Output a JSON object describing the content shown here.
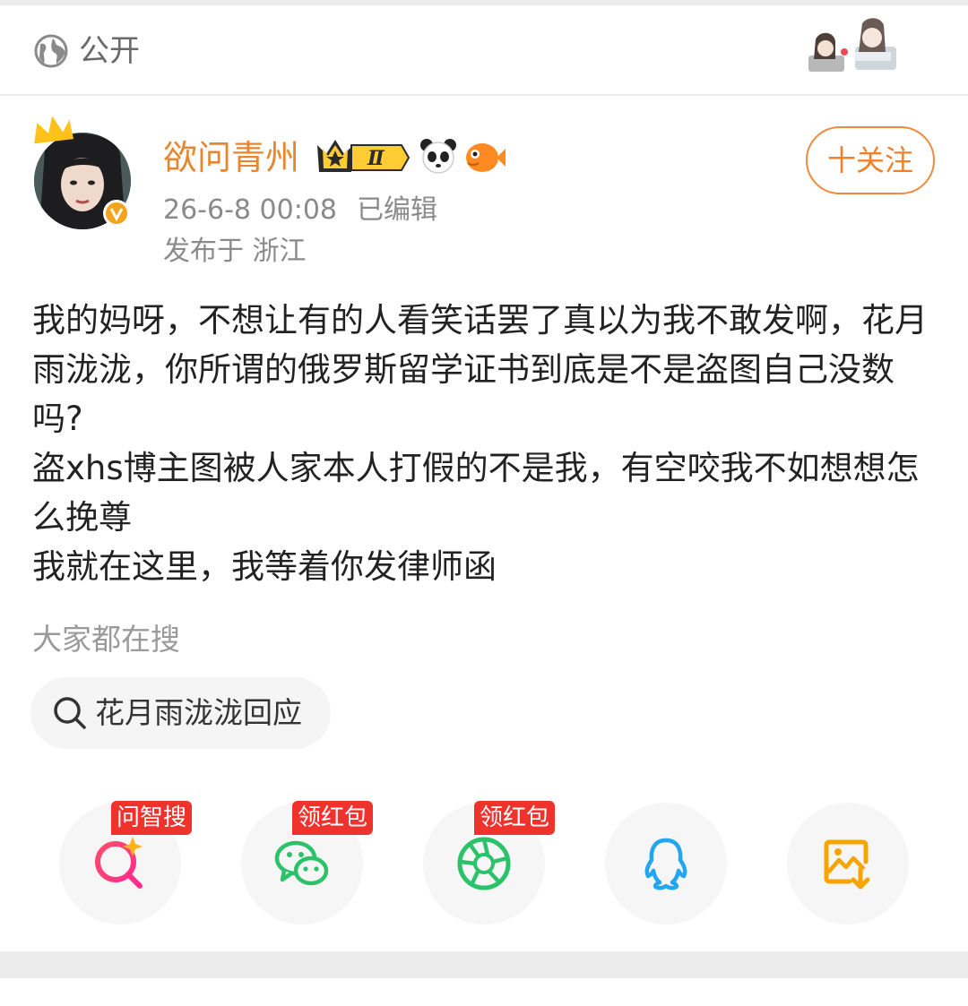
{
  "visibility": {
    "label": "公开",
    "icon": "globe-icon"
  },
  "author": {
    "name": "欲问青州",
    "timestamp": "26-6-8 00:08",
    "edited_label": "已编辑",
    "location": "发布于 浙江",
    "badge_level": "Ⅱ",
    "follow_label": "十关注"
  },
  "post": {
    "lines": [
      "我的妈呀，不想让有的人看笑话罢了真以为我不敢发啊，花月雨泷泷，你所谓的俄罗斯留学证书到底是不是盗图自己没数吗?",
      "盗xhs博主图被人家本人打假的不是我，有空咬我不如想想怎么挽尊",
      "我就在这里，我等着你发律师函"
    ]
  },
  "trending": {
    "title": "大家都在搜",
    "items": [
      "花月雨泷泷回应"
    ]
  },
  "share": {
    "items": [
      {
        "icon": "ai-search-icon",
        "tag": "问智搜"
      },
      {
        "icon": "wechat-icon",
        "tag": "领红包"
      },
      {
        "icon": "moments-icon",
        "tag": "领红包"
      },
      {
        "icon": "qq-icon",
        "tag": ""
      },
      {
        "icon": "save-image-icon",
        "tag": ""
      }
    ]
  },
  "colors": {
    "accent": "#f0812a",
    "username": "#e8862e",
    "tag_red": "#f0322c"
  }
}
